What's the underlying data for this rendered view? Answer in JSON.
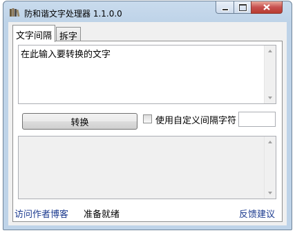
{
  "window": {
    "title": "防和谐文字处理器 1.1.0.0",
    "icon": "books-icon"
  },
  "tabs": [
    {
      "label": "文字间隔",
      "active": true
    },
    {
      "label": "拆字",
      "active": false
    }
  ],
  "input": {
    "value": "在此输入要转换的文字"
  },
  "controls": {
    "convert_label": "转换",
    "checkbox_label": "使用自定义间隔字符",
    "checkbox_checked": false,
    "separator_value": ""
  },
  "output": {
    "value": ""
  },
  "status": {
    "visit_blog": "访问作者博客",
    "ready": "准备就绪",
    "feedback": "反馈建议"
  },
  "colors": {
    "link": "#1b3a8f",
    "close_button": "#c75050"
  }
}
